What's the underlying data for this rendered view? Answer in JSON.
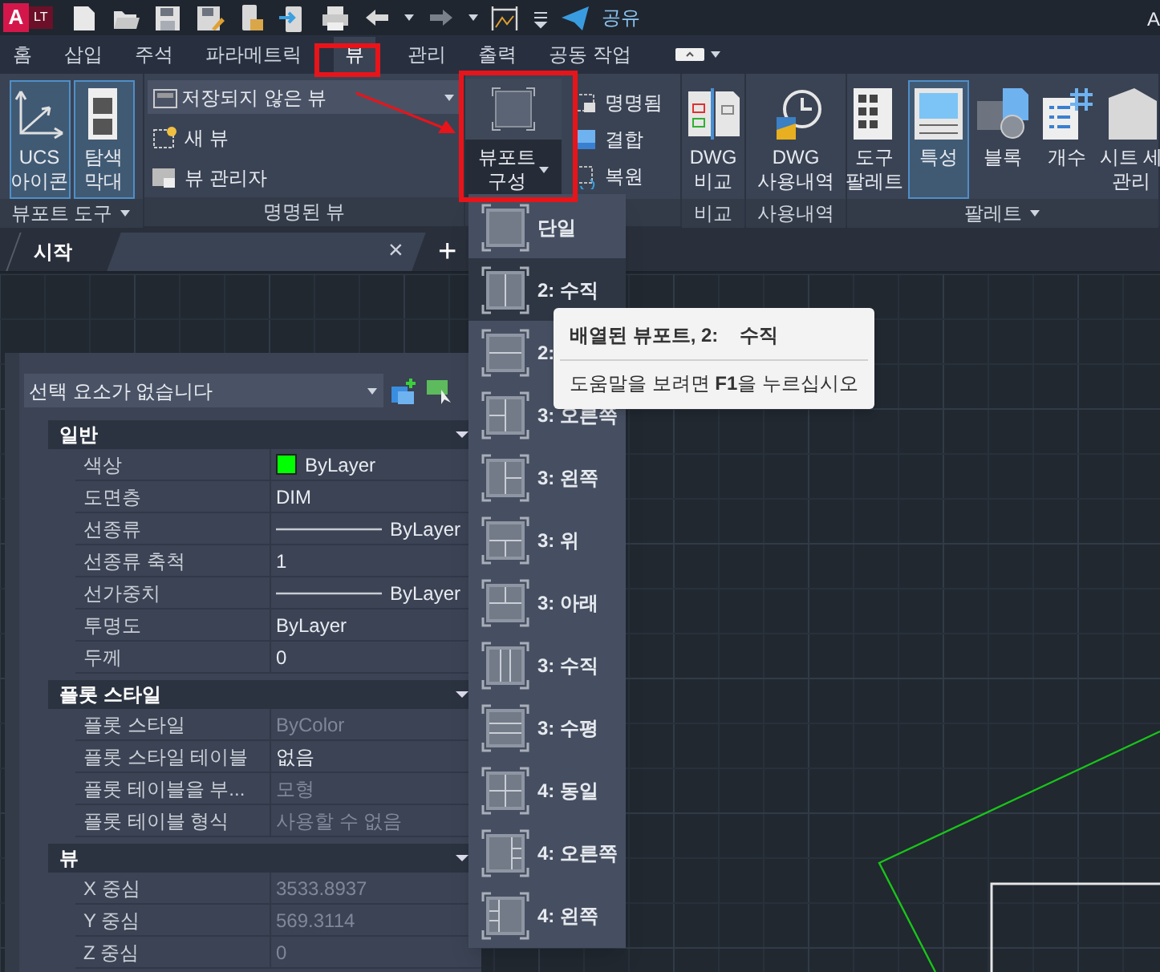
{
  "title_bar": {
    "logo": "A",
    "badge": "LT",
    "share": "공유",
    "title": "A"
  },
  "tabs": [
    {
      "label": "홈",
      "selected": false
    },
    {
      "label": "삽입",
      "selected": false
    },
    {
      "label": "주석",
      "selected": false
    },
    {
      "label": "파라메트릭",
      "selected": false
    },
    {
      "label": "뷰",
      "selected": true
    },
    {
      "label": "관리",
      "selected": false
    },
    {
      "label": "출력",
      "selected": false
    },
    {
      "label": "공동 작업",
      "selected": false
    }
  ],
  "ribbon_panels": [
    {
      "kind": "large",
      "label": "뷰포트 도구",
      "menu": true,
      "buttons": [
        {
          "lines": [
            "UCS",
            "아이콘"
          ],
          "selected": true
        },
        {
          "lines": [
            "탐색",
            "막대"
          ],
          "selected": true
        }
      ]
    },
    {
      "kind": "named_views",
      "label": "명명된 뷰",
      "dropdown": "저장되지 않은 뷰",
      "items": [
        "새 뷰",
        "뷰 관리자"
      ]
    },
    {
      "kind": "viewport",
      "button": [
        "뷰포트",
        "구성"
      ],
      "open": true,
      "items": [
        "명명됨",
        "결합",
        "복원"
      ]
    },
    {
      "kind": "large",
      "label": "비교",
      "menu": false,
      "buttons": [
        {
          "lines": [
            "DWG",
            "비교"
          ],
          "selected": false
        }
      ]
    },
    {
      "kind": "large",
      "label": "사용내역",
      "menu": false,
      "buttons": [
        {
          "lines": [
            "DWG",
            "사용내역"
          ],
          "selected": false
        }
      ]
    },
    {
      "kind": "large",
      "label": "팔레트",
      "menu": true,
      "buttons": [
        {
          "lines": [
            "도구",
            "팔레트"
          ],
          "selected": false
        },
        {
          "lines": [
            "특성"
          ],
          "selected": true
        },
        {
          "lines": [
            "블록"
          ],
          "selected": false
        },
        {
          "lines": [
            "개수"
          ],
          "selected": false
        },
        {
          "lines": [
            "시트 세",
            "관리"
          ],
          "selected": false
        }
      ]
    }
  ],
  "file_tabs": [
    {
      "label": "시작",
      "selected": false
    },
    {
      "close": "×",
      "selected": true
    }
  ],
  "new_tab": "+",
  "viewport_menu": [
    {
      "label": "단일",
      "highlighted": false
    },
    {
      "label": "2: 수직",
      "highlighted": true
    },
    {
      "label": "2:",
      "highlighted": false
    },
    {
      "label": "3: 오른쪽",
      "highlighted": false
    },
    {
      "label": "3: 왼쪽",
      "highlighted": false
    },
    {
      "label": "3: 위",
      "highlighted": false
    },
    {
      "label": "3: 아래",
      "highlighted": false
    },
    {
      "label": "3: 수직",
      "highlighted": false
    },
    {
      "label": "3: 수평",
      "highlighted": false
    },
    {
      "label": "4: 동일",
      "highlighted": false
    },
    {
      "label": "4: 오른쪽",
      "highlighted": false
    },
    {
      "label": "4: 왼쪽",
      "highlighted": false
    }
  ],
  "tooltip": {
    "title": "배열된 뷰포트, 2:    수직",
    "help": "도움말을 보려면 **F1**을 누르십시오"
  },
  "properties": {
    "selection": "선택 요소가 없습니다",
    "sections": [
      {
        "title": "일반",
        "expanded": true,
        "rows": [
          {
            "label": "색상",
            "value": "ByLayer",
            "kind": "color",
            "color": "#00ff00",
            "disabled": false
          },
          {
            "label": "도면층",
            "value": "DIM",
            "kind": "text",
            "disabled": false
          },
          {
            "label": "선종류",
            "value": "ByLayer",
            "kind": "line",
            "disabled": false
          },
          {
            "label": "선종류 축척",
            "value": "1",
            "kind": "text",
            "disabled": false
          },
          {
            "label": "선가중치",
            "value": "ByLayer",
            "kind": "line",
            "disabled": false
          },
          {
            "label": "투명도",
            "value": "ByLayer",
            "kind": "text",
            "disabled": false
          },
          {
            "label": "두께",
            "value": "0",
            "kind": "text",
            "disabled": false
          }
        ]
      },
      {
        "title": "플롯 스타일",
        "expanded": true,
        "rows": [
          {
            "label": "플롯 스타일",
            "value": "ByColor",
            "kind": "text",
            "disabled": true
          },
          {
            "label": "플롯 스타일 테이블",
            "value": "없음",
            "kind": "text",
            "disabled": false
          },
          {
            "label": "플롯 테이블을 부...",
            "value": "모형",
            "kind": "text",
            "disabled": true
          },
          {
            "label": "플롯 테이블 형식",
            "value": "사용할 수 없음",
            "kind": "text",
            "disabled": true
          }
        ]
      },
      {
        "title": "뷰",
        "expanded": true,
        "rows": [
          {
            "label": "X 중심",
            "value": "3533.8937",
            "kind": "text",
            "disabled": true
          },
          {
            "label": "Y 중심",
            "value": "569.3114",
            "kind": "text",
            "disabled": true
          },
          {
            "label": "Z 중심",
            "value": "0",
            "kind": "text",
            "disabled": true
          }
        ]
      }
    ]
  }
}
